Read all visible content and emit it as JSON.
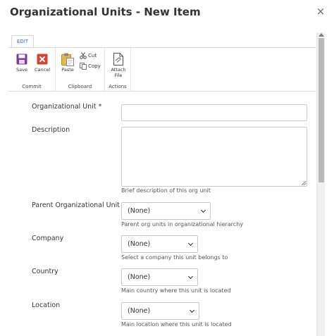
{
  "dialog": {
    "title": "Organizational Units - New Item",
    "close_glyph": "×"
  },
  "ribbon": {
    "tab_label": "EDIT",
    "groups": {
      "commit": {
        "label": "Commit",
        "save_label": "Save",
        "cancel_label": "Cancel"
      },
      "clipboard": {
        "label": "Clipboard",
        "paste_label": "Paste",
        "cut_label": "Cut",
        "copy_label": "Copy"
      },
      "actions": {
        "label": "Actions",
        "attach_line1": "Attach",
        "attach_line2": "File"
      }
    },
    "colors": {
      "save_icon": "#7d3c9c",
      "cancel_icon": "#d9432e",
      "paste_icon": "#e8b84a",
      "tab_text": "#3a6bbf"
    }
  },
  "form": {
    "org_unit": {
      "label": "Organizational Unit",
      "required_marker": "*",
      "value": ""
    },
    "description": {
      "label": "Description",
      "value": "",
      "hint": "Brief description of this org unit"
    },
    "parent_unit": {
      "label": "Parent Organizational Unit",
      "selected": "(None)",
      "hint": "Parent org units in organizational hierarchy"
    },
    "company": {
      "label": "Company",
      "selected": "(None)",
      "hint": "Select a company this unit belongs to"
    },
    "country": {
      "label": "Country",
      "selected": "(None)",
      "hint": "Main country where this unit is located"
    },
    "location": {
      "label": "Location",
      "selected": "(None)",
      "hint": "Main location where this unit is located"
    }
  }
}
